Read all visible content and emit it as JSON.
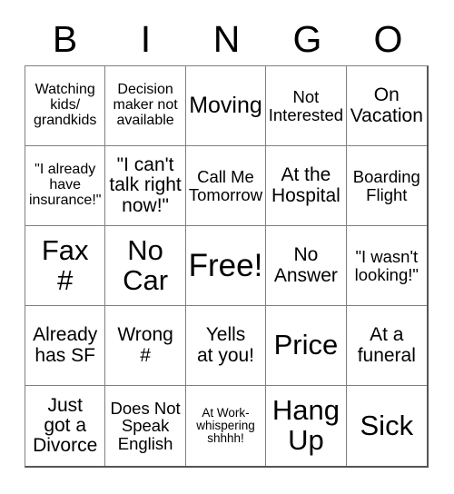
{
  "card": {
    "header_letters": [
      "B",
      "I",
      "N",
      "G",
      "O"
    ],
    "grid": {
      "columns": 5,
      "rows": 5,
      "cells": [
        {
          "text": "Watching\nkids/\ngrandkids",
          "size": "s"
        },
        {
          "text": "Decision\nmaker not\navailable",
          "size": "s"
        },
        {
          "text": "Moving",
          "size": "xl"
        },
        {
          "text": "Not\nInterested",
          "size": "m"
        },
        {
          "text": "On\nVacation",
          "size": "l"
        },
        {
          "text": "\"I already\nhave\ninsurance!\"",
          "size": "s"
        },
        {
          "text": "\"I can't\ntalk right\nnow!\"",
          "size": "l"
        },
        {
          "text": "Call Me\nTomorrow",
          "size": "m"
        },
        {
          "text": "At the\nHospital",
          "size": "l"
        },
        {
          "text": "Boarding\nFlight",
          "size": "m"
        },
        {
          "text": "Fax\n#",
          "size": "xxl"
        },
        {
          "text": "No\nCar",
          "size": "xxl"
        },
        {
          "text": "Free!",
          "size": "huge"
        },
        {
          "text": "No\nAnswer",
          "size": "l"
        },
        {
          "text": "\"I wasn't\nlooking!\"",
          "size": "m"
        },
        {
          "text": "Already\nhas SF",
          "size": "l"
        },
        {
          "text": "Wrong\n#",
          "size": "l"
        },
        {
          "text": "Yells\nat you!",
          "size": "l"
        },
        {
          "text": "Price",
          "size": "xxl"
        },
        {
          "text": "At a\nfuneral",
          "size": "l"
        },
        {
          "text": "Just\ngot a\nDivorce",
          "size": "l"
        },
        {
          "text": "Does Not\nSpeak\nEnglish",
          "size": "m"
        },
        {
          "text": "At Work-\nwhispering\nshhhh!",
          "size": "xs"
        },
        {
          "text": "Hang\nUp",
          "size": "xxl"
        },
        {
          "text": "Sick",
          "size": "xxl"
        }
      ]
    },
    "colors": {
      "background": "#ffffff",
      "text": "#000000",
      "grid_line": "#808080",
      "grid_outer": "#555555"
    }
  }
}
